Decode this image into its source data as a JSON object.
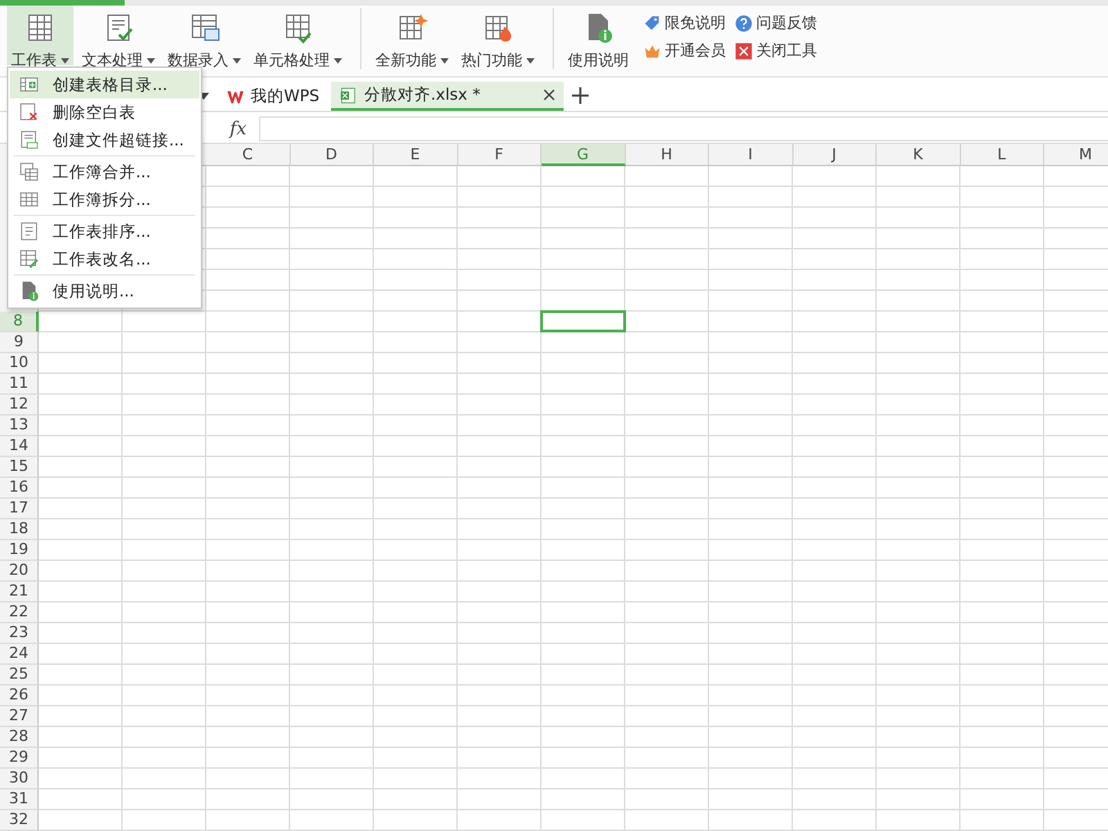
{
  "ribbon": {
    "buttons": [
      {
        "label": "工作表",
        "caret": true,
        "selected": true
      },
      {
        "label": "文本处理",
        "caret": true,
        "selected": false
      },
      {
        "label": "数据录入",
        "caret": true,
        "selected": false
      },
      {
        "label": "单元格处理",
        "caret": true,
        "selected": false
      },
      {
        "label": "全新功能",
        "caret": true,
        "selected": false,
        "group_start": true
      },
      {
        "label": "热门功能",
        "caret": true,
        "selected": false
      },
      {
        "label": "使用说明",
        "caret": false,
        "selected": false,
        "group_start": true
      }
    ],
    "links": [
      {
        "label": "限免说明"
      },
      {
        "label": "问题反馈"
      },
      {
        "label": "开通会员"
      },
      {
        "label": "关闭工具"
      }
    ]
  },
  "menu": {
    "items": [
      {
        "label": "创建表格目录...",
        "selected": true
      },
      {
        "label": "删除空白表",
        "selected": false
      },
      {
        "label": "创建文件超链接...",
        "selected": false,
        "separator_after": true
      },
      {
        "label": "工作簿合并...",
        "selected": false
      },
      {
        "label": "工作簿拆分...",
        "selected": false,
        "separator_after": true
      },
      {
        "label": "工作表排序...",
        "selected": false
      },
      {
        "label": "工作表改名...",
        "selected": false,
        "separator_after": true
      },
      {
        "label": "使用说明...",
        "selected": false
      }
    ]
  },
  "tabs": [
    {
      "label": "我的WPS",
      "kind": "home",
      "selected": false
    },
    {
      "label": "分散对齐.xlsx *",
      "kind": "file",
      "selected": true
    }
  ],
  "formula_bar": {
    "fx": "fx"
  },
  "sheet": {
    "columns": [
      {
        "label": "C",
        "selected": false
      },
      {
        "label": "D",
        "selected": false
      },
      {
        "label": "E",
        "selected": false
      },
      {
        "label": "F",
        "selected": false
      },
      {
        "label": "G",
        "selected": true
      },
      {
        "label": "H",
        "selected": false
      },
      {
        "label": "I",
        "selected": false
      },
      {
        "label": "J",
        "selected": false
      },
      {
        "label": "K",
        "selected": false
      },
      {
        "label": "L",
        "selected": false
      },
      {
        "label": "M",
        "selected": false
      }
    ],
    "rows": [
      {
        "label": "8",
        "selected": true
      },
      {
        "label": "9",
        "selected": false
      },
      {
        "label": "10",
        "selected": false
      },
      {
        "label": "11",
        "selected": false
      },
      {
        "label": "12",
        "selected": false
      },
      {
        "label": "13",
        "selected": false
      },
      {
        "label": "14",
        "selected": false
      },
      {
        "label": "15",
        "selected": false
      },
      {
        "label": "16",
        "selected": false
      },
      {
        "label": "17",
        "selected": false
      },
      {
        "label": "18",
        "selected": false
      },
      {
        "label": "19",
        "selected": false
      },
      {
        "label": "20",
        "selected": false
      },
      {
        "label": "21",
        "selected": false
      },
      {
        "label": "22",
        "selected": false
      },
      {
        "label": "23",
        "selected": false
      },
      {
        "label": "24",
        "selected": false
      },
      {
        "label": "25",
        "selected": false
      },
      {
        "label": "26",
        "selected": false
      },
      {
        "label": "27",
        "selected": false
      },
      {
        "label": "28",
        "selected": false
      },
      {
        "label": "29",
        "selected": false
      },
      {
        "label": "30",
        "selected": false
      },
      {
        "label": "31",
        "selected": false
      },
      {
        "label": "32",
        "selected": false
      }
    ]
  }
}
